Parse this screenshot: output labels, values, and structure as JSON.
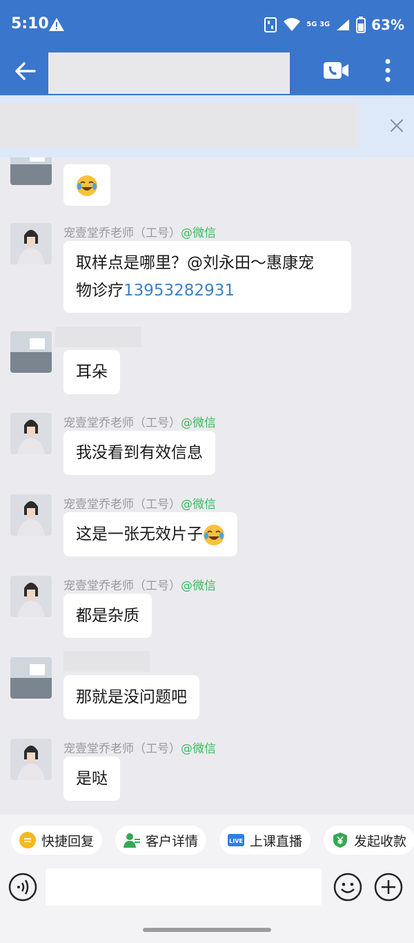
{
  "status_bar": {
    "time": "5:10",
    "network": "5G 3G",
    "battery": "63%"
  },
  "header": {
    "back_icon": "back-arrow-icon",
    "video_icon": "video-call-icon",
    "more_icon": "more-vertical-icon"
  },
  "colors": {
    "header_bg": "#3a76cc",
    "chat_bg": "#ebebef",
    "wechat_green": "#3cb95b",
    "link_blue": "#3a82c8"
  },
  "messages": [
    {
      "sender_name": "",
      "tag": "",
      "text": "",
      "emoji": "laugh-cry-emoji"
    },
    {
      "sender_name": "宠壹堂乔老师（工号）",
      "tag": "@微信",
      "text": "取样点是哪里？@刘永田～惠康宠",
      "text2": "物诊疗",
      "phone": "13953282931"
    },
    {
      "sender_name": "",
      "tag": "",
      "text": "耳朵"
    },
    {
      "sender_name": "宠壹堂乔老师（工号）",
      "tag": "@微信",
      "text": "我没看到有效信息"
    },
    {
      "sender_name": "宠壹堂乔老师（工号）",
      "tag": "@微信",
      "text": "这是一张无效片子",
      "emoji": "laugh-cry-emoji"
    },
    {
      "sender_name": "宠壹堂乔老师（工号）",
      "tag": "@微信",
      "text": "都是杂质"
    },
    {
      "sender_name": "",
      "tag": "",
      "text": "那就是没问题吧"
    },
    {
      "sender_name": "宠壹堂乔老师（工号）",
      "tag": "@微信",
      "text": "是哒"
    }
  ],
  "quick_actions": [
    {
      "label": "快捷回复",
      "icon": "quick-reply-icon"
    },
    {
      "label": "客户详情",
      "icon": "customer-detail-icon"
    },
    {
      "label": "上课直播",
      "icon": "live-icon",
      "badge": "LIVE"
    },
    {
      "label": "发起收款",
      "icon": "payment-icon"
    }
  ],
  "input": {
    "placeholder": ""
  }
}
